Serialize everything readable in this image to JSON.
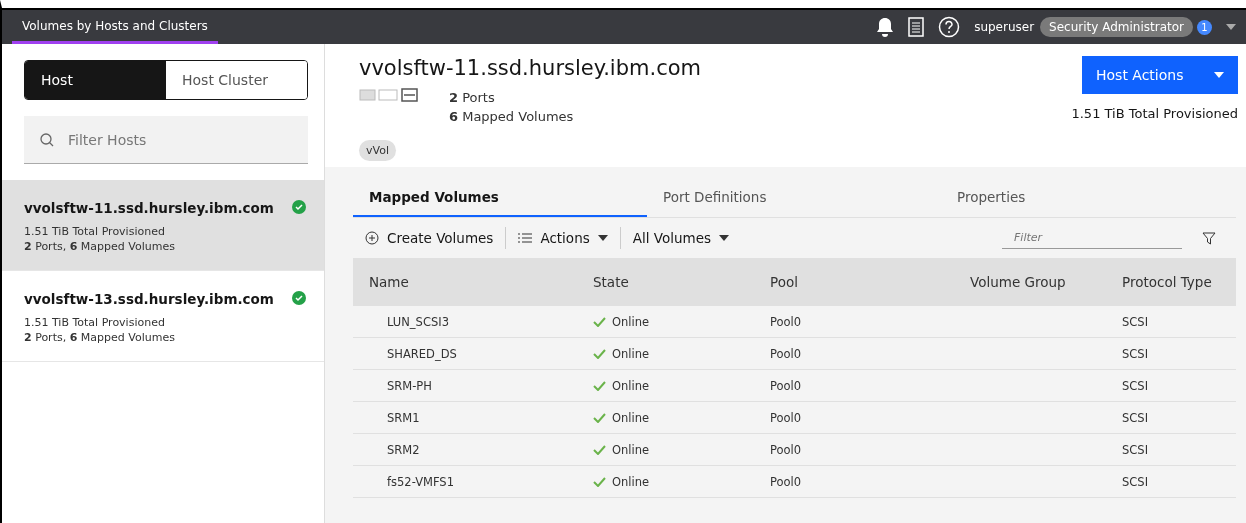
{
  "top_bar": {
    "tabs": [
      {
        "label": "Volumes by Hosts and Clusters",
        "selected": true
      }
    ],
    "user": "superuser",
    "role": "Security Administrator",
    "notification_count": "1"
  },
  "sidebar": {
    "toggle": [
      {
        "label": "Host",
        "selected": true
      },
      {
        "label": "Host Cluster",
        "selected": false
      }
    ],
    "search": {
      "placeholder": "Filter Hosts"
    },
    "hosts": [
      {
        "name": "vvolsftw-11.ssd.hursley.ibm.com",
        "provisioned": "1.51 TiB Total Provisioned",
        "summary": "**2** Ports, **6** Mapped Volumes",
        "selected": true
      },
      {
        "name": "vvolsftw-13.ssd.hursley.ibm.com",
        "provisioned": "1.51 TiB Total Provisioned",
        "summary": "**2** Ports, **6** Mapped Volumes",
        "selected": false
      }
    ]
  },
  "detail": {
    "title": "vvolsftw-11.ssd.hursley.ibm.com",
    "ports": "**2** Ports",
    "volumes": "**6** Mapped Volumes",
    "tag": "vVol",
    "action_button": "Host Actions",
    "provisioned": "1.51 TiB Total Provisioned",
    "tabs": [
      {
        "label": "Mapped Volumes",
        "selected": true
      },
      {
        "label": "Port Definitions",
        "selected": false
      },
      {
        "label": "Properties",
        "selected": false
      }
    ],
    "toolbar": {
      "create": "Create Volumes",
      "actions": "Actions",
      "view": "All Volumes",
      "filter_placeholder": "Filter"
    },
    "table": {
      "columns": [
        "Name",
        "State",
        "Pool",
        "Volume Group",
        "Protocol Type"
      ],
      "rows": [
        {
          "name": "LUN_SCSI3",
          "state": "Online",
          "pool": "Pool0",
          "volume_group": "",
          "protocol": "SCSI"
        },
        {
          "name": "SHARED_DS",
          "state": "Online",
          "pool": "Pool0",
          "volume_group": "",
          "protocol": "SCSI"
        },
        {
          "name": "SRM-PH",
          "state": "Online",
          "pool": "Pool0",
          "volume_group": "",
          "protocol": "SCSI"
        },
        {
          "name": "SRM1",
          "state": "Online",
          "pool": "Pool0",
          "volume_group": "",
          "protocol": "SCSI"
        },
        {
          "name": "SRM2",
          "state": "Online",
          "pool": "Pool0",
          "volume_group": "",
          "protocol": "SCSI"
        },
        {
          "name": "fs52-VMFS1",
          "state": "Online",
          "pool": "Pool0",
          "volume_group": "",
          "protocol": "SCSI"
        }
      ]
    }
  }
}
